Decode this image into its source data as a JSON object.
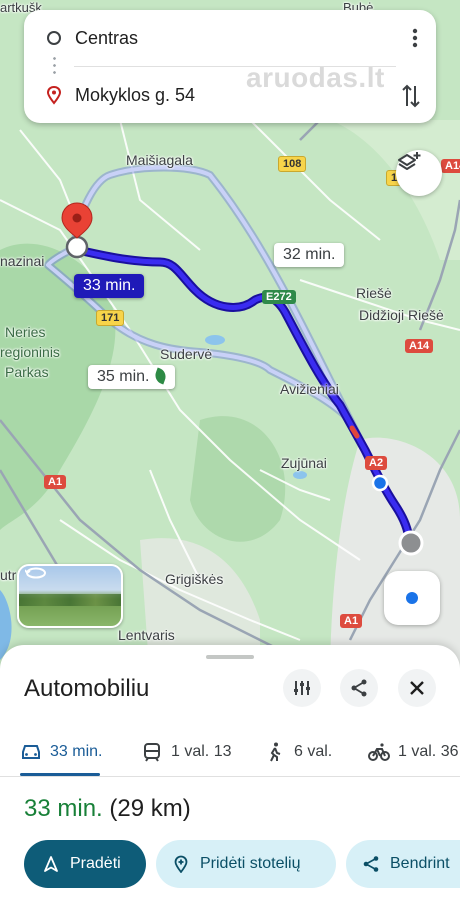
{
  "search": {
    "origin": "Centras",
    "destination": "Mokyklos g. 54",
    "watermark": "aruodas.lt"
  },
  "map": {
    "places": [
      "Maišiagala",
      "Riešė",
      "Didžioji Riešė",
      "Neries",
      "regioninis",
      "Parkas",
      "Sudervė",
      "Avižieniai",
      "Zujūnai",
      "Grigiškės",
      "Lentvaris",
      "nazinai",
      "artkušk",
      "Bubė",
      "utr"
    ],
    "road_shields": {
      "r108": "108",
      "a14_top": "A14",
      "r1": "1",
      "e272": "E272",
      "r171": "171",
      "a14_mid": "A14",
      "a2": "A2",
      "a1_left": "A1",
      "a1_bottom": "A1"
    },
    "routes": {
      "active": "33 min.",
      "alt_1": "32 min.",
      "alt_2": "35 min."
    },
    "icons": [
      "layers-icon",
      "location-pin-icon",
      "my-location-icon",
      "street-view-thumbnail"
    ]
  },
  "sheet": {
    "title": "Automobiliu",
    "modes": [
      {
        "label": "33 min.",
        "icon": "car-icon",
        "active": true
      },
      {
        "label": "1 val. 13",
        "icon": "transit-icon",
        "active": false
      },
      {
        "label": "6 val.",
        "icon": "walk-icon",
        "active": false
      },
      {
        "label": "1 val. 36",
        "icon": "bike-icon",
        "active": false
      }
    ],
    "summary_time": "33 min.",
    "summary_distance": "(29 km)",
    "actions": {
      "start": "Pradėti",
      "add_stops": "Pridėti stotelių",
      "share": "Bendrint"
    }
  },
  "colors": {
    "route_active": "#2a1fd0",
    "route_alt": "#a8b4f0",
    "time_green": "#188038",
    "accent_blue": "#1a5c97",
    "start_button": "#0e5c78",
    "secondary_button": "#d7f0f7",
    "map_green": "#c7e8c6"
  }
}
